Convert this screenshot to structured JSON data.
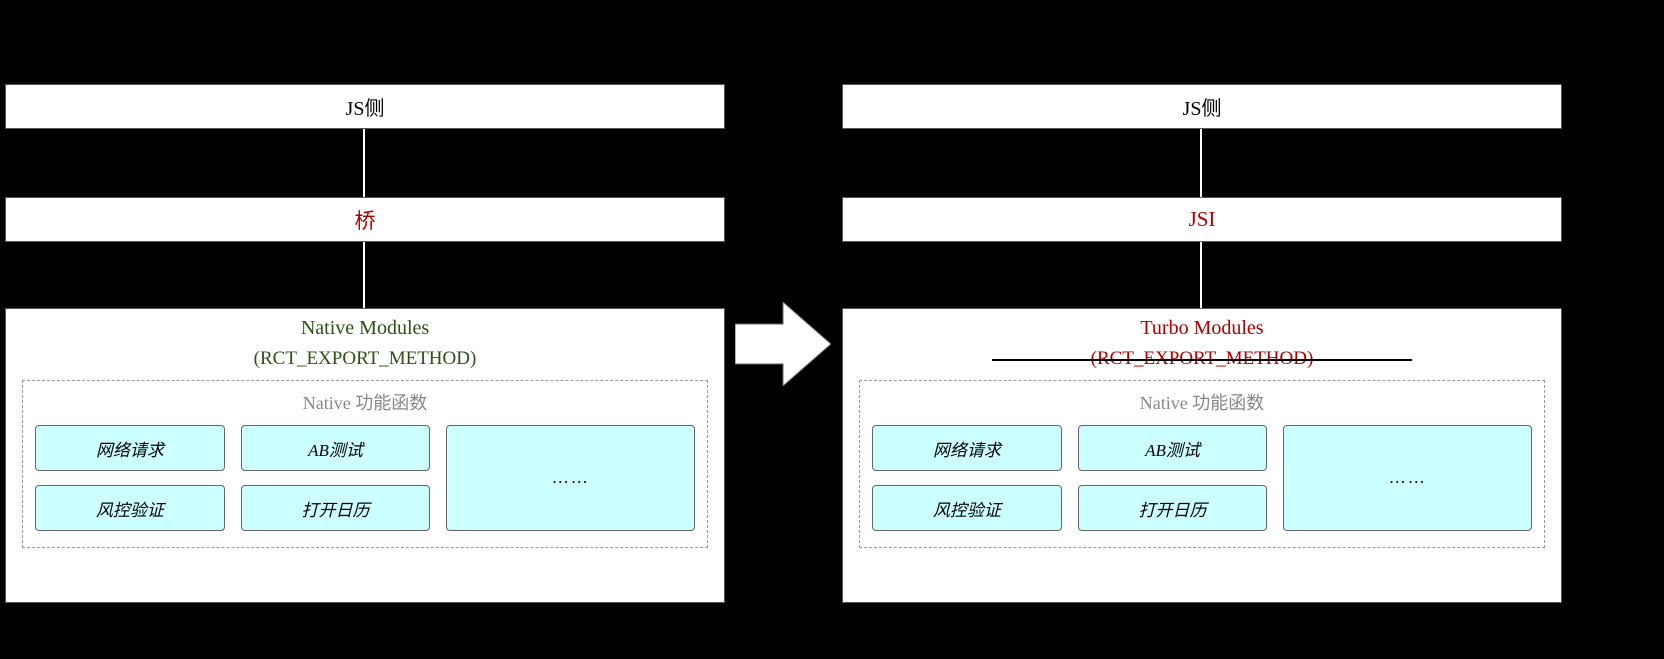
{
  "left": {
    "jsLabel": "JS侧",
    "midLabel": "桥",
    "modulesTitle": "Native Modules",
    "modulesSub": "(RCT_EXPORT_METHOD)",
    "funcTitle": "Native 功能函数",
    "funcs": {
      "f1": "网络请求",
      "f2": "AB测试",
      "f3": "风控验证",
      "f4": "打开日历",
      "more": "……"
    }
  },
  "right": {
    "jsLabel": "JS侧",
    "midLabel": "JSI",
    "modulesTitle": "Turbo Modules",
    "modulesSub": "(RCT_EXPORT_METHOD)",
    "funcTitle": "Native 功能函数",
    "funcs": {
      "f1": "网络请求",
      "f2": "AB测试",
      "f3": "风控验证",
      "f4": "打开日历",
      "more": "……"
    }
  }
}
